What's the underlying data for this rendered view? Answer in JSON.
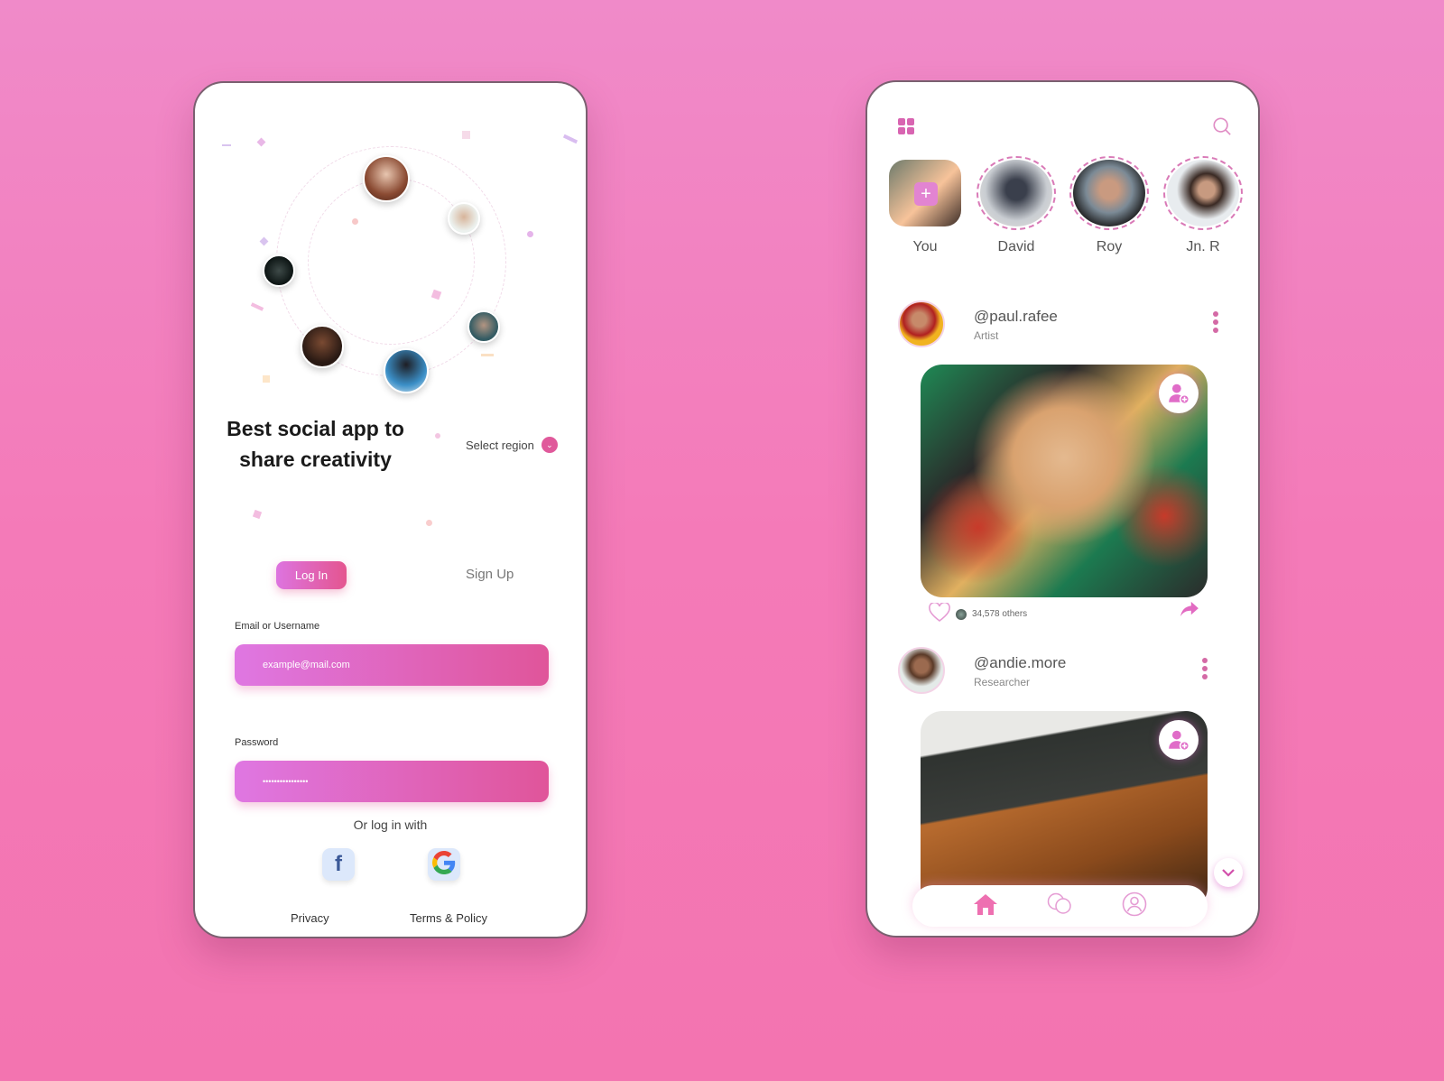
{
  "login": {
    "headline": "Best social app to share creativity",
    "select_region": "Select region",
    "tabs": {
      "login": "Log In",
      "signup": "Sign Up"
    },
    "email_label": "Email or Username",
    "email_value": "example@mail.com",
    "password_label": "Password",
    "password_value": "••••••••••••••••",
    "or_text": "Or log in with",
    "social": {
      "facebook": "f",
      "google": "G"
    },
    "footer": {
      "privacy": "Privacy",
      "terms": "Terms & Policy"
    }
  },
  "feed": {
    "stories": [
      {
        "name": "You",
        "add": "+"
      },
      {
        "name": "David"
      },
      {
        "name": "Roy"
      },
      {
        "name": "Jn. R"
      }
    ],
    "posts": [
      {
        "handle": "@paul.rafee",
        "role": "Artist",
        "likes": "34,578 others"
      },
      {
        "handle": "@andie.more",
        "role": "Researcher"
      }
    ]
  },
  "colors": {
    "accent": "#e0559a",
    "accent_light": "#df77e2"
  }
}
